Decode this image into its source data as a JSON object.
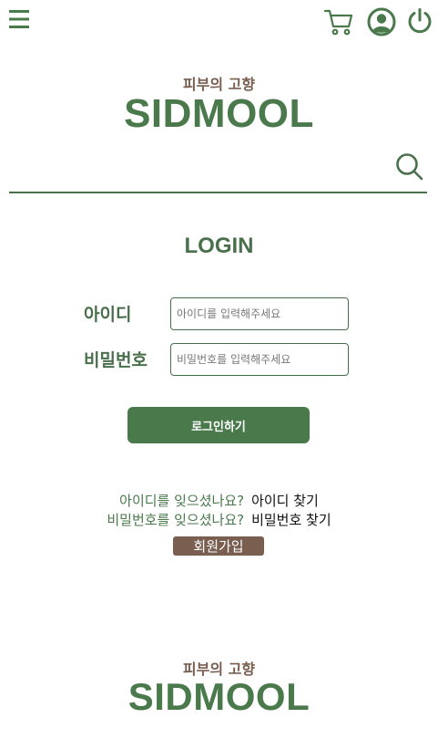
{
  "header": {
    "icons": [
      "menu-icon",
      "cart-icon",
      "user-icon",
      "power-icon"
    ],
    "colors": {
      "green": "#4a7a4c",
      "brown": "#7a5e50"
    }
  },
  "brand": {
    "tagline": "피부의 고향",
    "name": "SIDMOOL"
  },
  "search": {
    "value": "",
    "placeholder": "",
    "icon": "search-icon"
  },
  "login": {
    "title": "LOGIN",
    "id_label": "아이디",
    "id_placeholder": "아이디를 입력해주세요",
    "pw_label": "비밀번호",
    "pw_placeholder": "비밀번호를 입력해주세요",
    "submit_label": "로그인하기"
  },
  "help": {
    "find_id_question": "아이디를 잊으셨나요?",
    "find_id_link": "아이디 찾기",
    "find_pw_question": "비밀번호를 잊으셨나요?",
    "find_pw_link": "비밀번호 찾기",
    "signup_label": "회원가입"
  },
  "footer": {
    "tagline": "피부의 고향",
    "name": "SIDMOOL"
  }
}
